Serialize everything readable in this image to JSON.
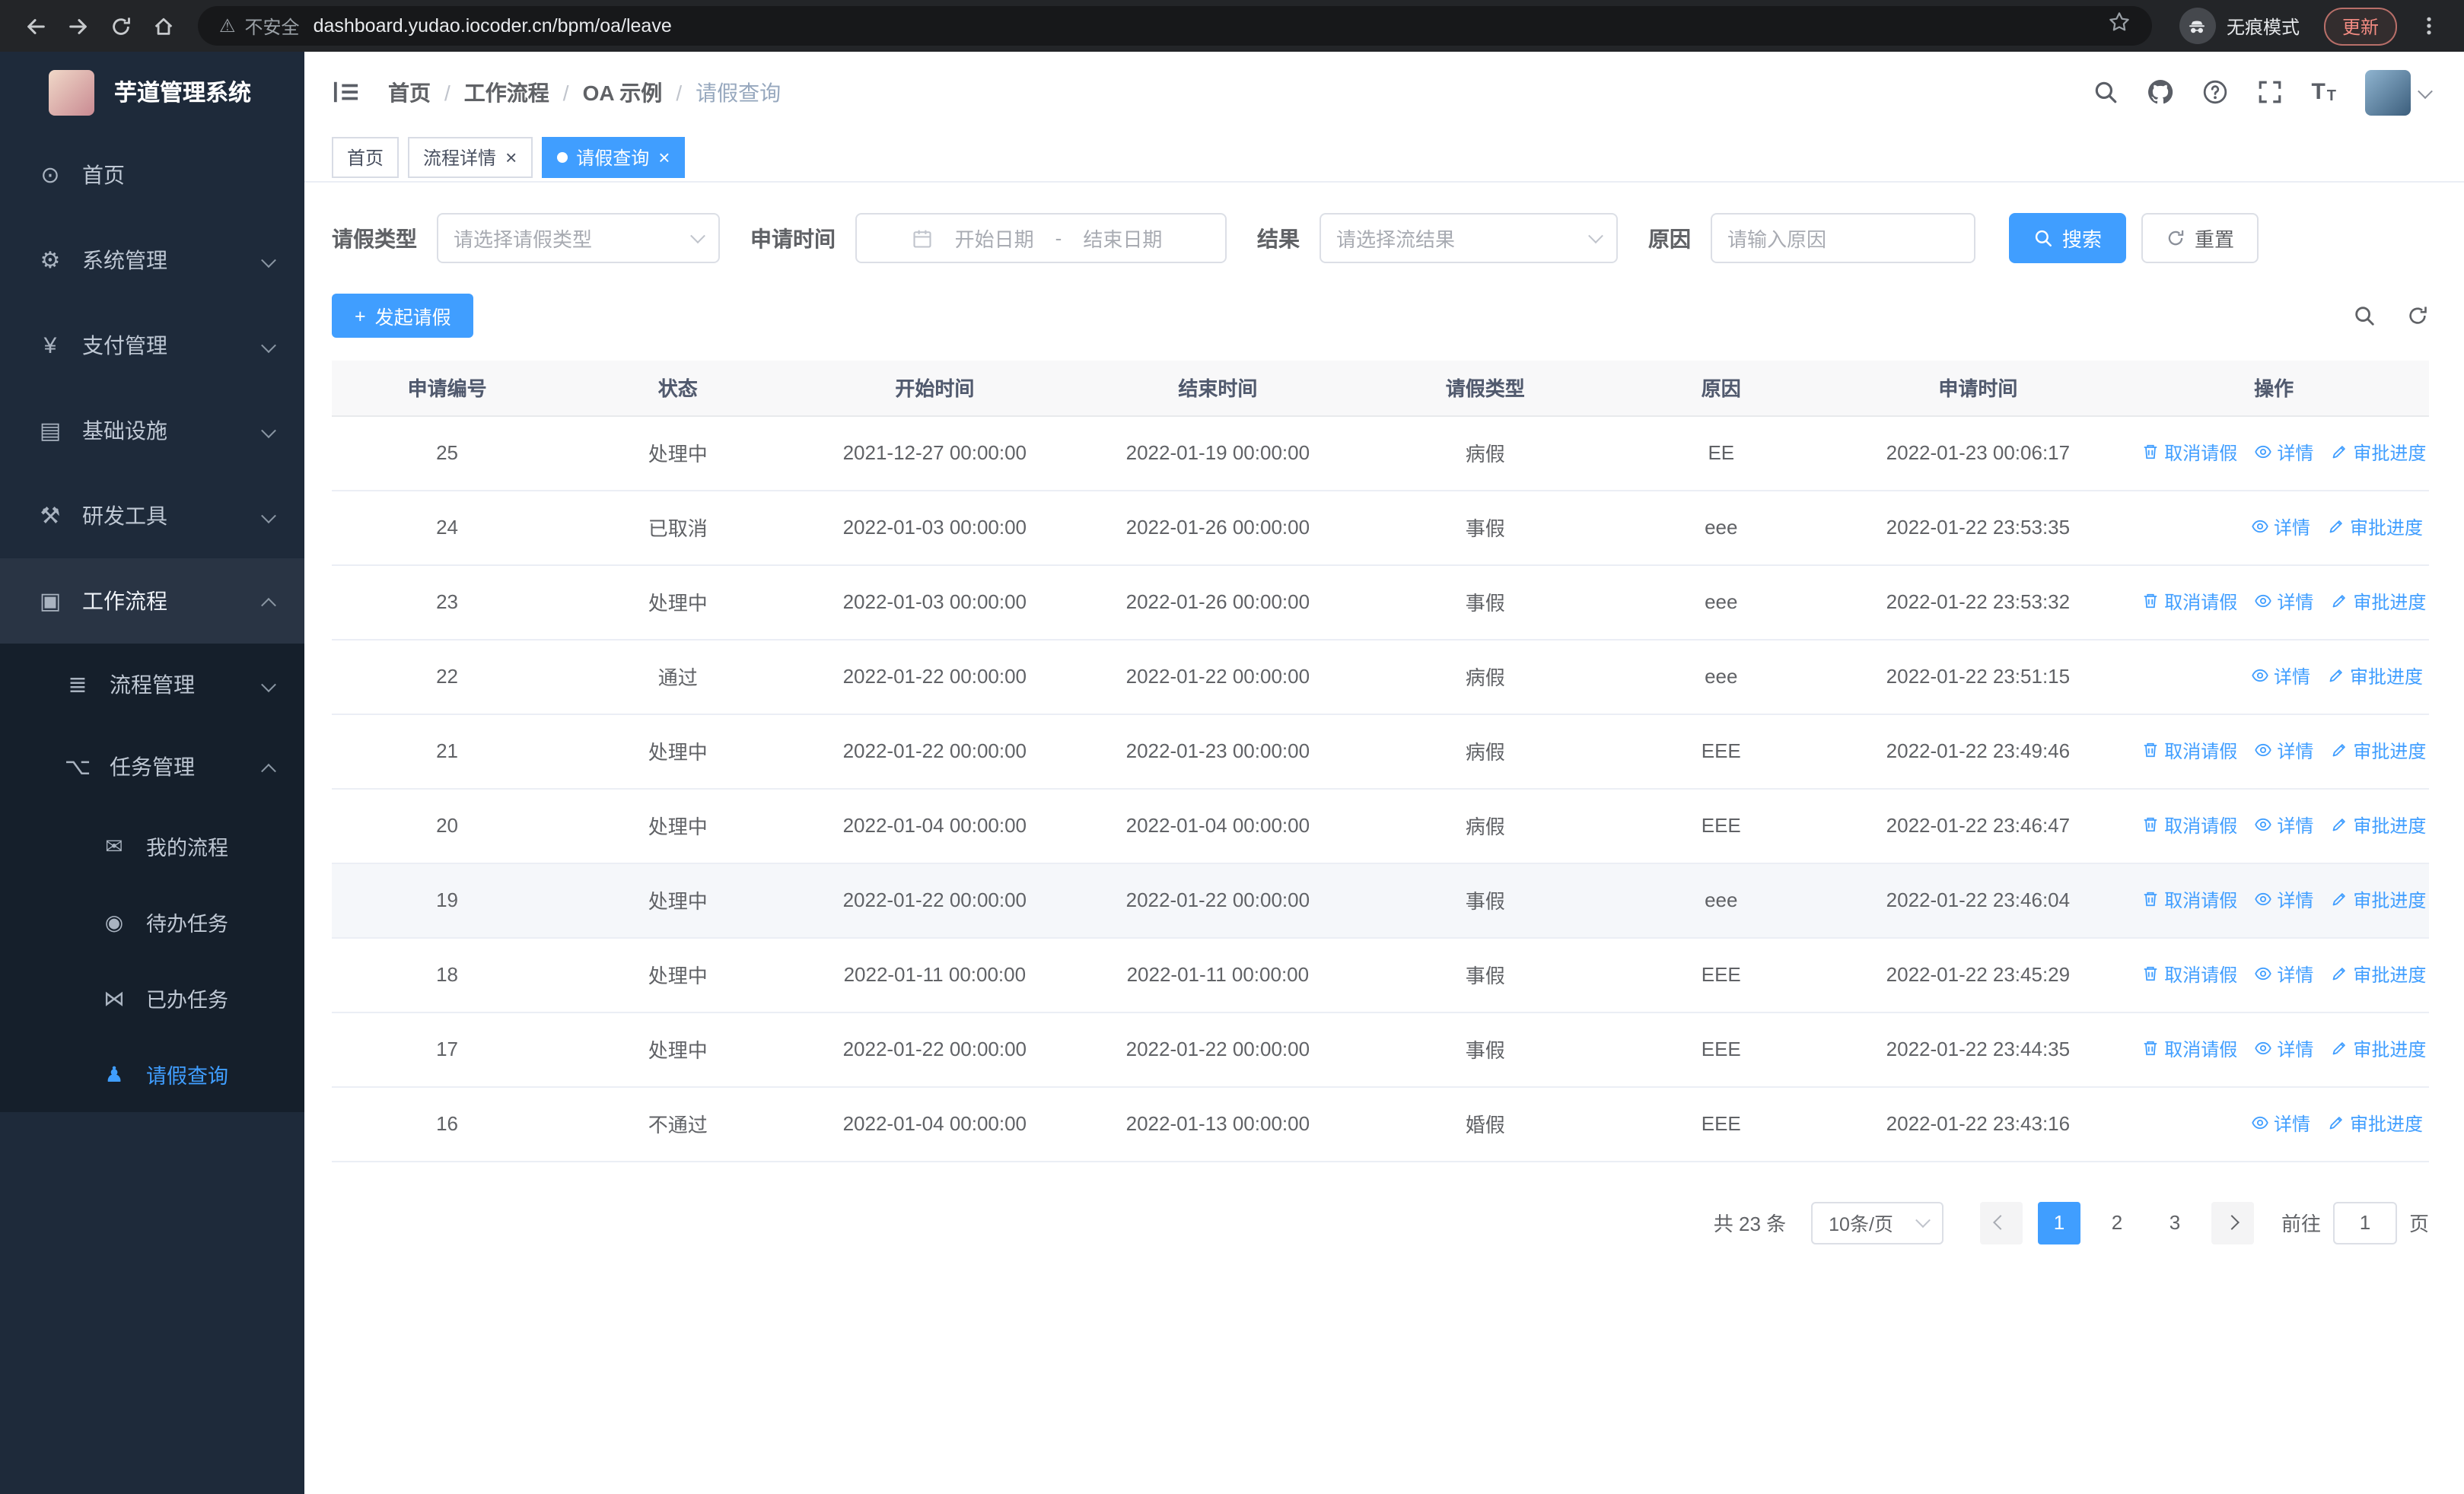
{
  "browser": {
    "security_label": "不安全",
    "url": "dashboard.yudao.iocoder.cn/bpm/oa/leave",
    "incognito_label": "无痕模式",
    "update_label": "更新"
  },
  "ui": {
    "close_glyph": "×",
    "warning_glyph": "⚠",
    "plus_glyph": "+",
    "font_icon_large": "T",
    "font_icon_small": "T"
  },
  "sidebar": {
    "logo_title": "芋道管理系统",
    "menu": [
      {
        "label": "首页",
        "glyph": "⊙"
      },
      {
        "label": "系统管理",
        "glyph": "⚙"
      },
      {
        "label": "支付管理",
        "glyph": "¥"
      },
      {
        "label": "基础设施",
        "glyph": "▤"
      },
      {
        "label": "研发工具",
        "glyph": "⚒"
      },
      {
        "label": "工作流程",
        "glyph": "▣"
      }
    ],
    "submenu": [
      {
        "label": "流程管理",
        "glyph": "≣"
      },
      {
        "label": "任务管理",
        "glyph": "⌥"
      }
    ],
    "task_items": [
      {
        "label": "我的流程",
        "glyph": "✉"
      },
      {
        "label": "待办任务",
        "glyph": "◉"
      },
      {
        "label": "已办任务",
        "glyph": "⋈"
      },
      {
        "label": "请假查询",
        "glyph": "♟"
      }
    ]
  },
  "header": {
    "breadcrumb": [
      "首页",
      "工作流程",
      "OA 示例",
      "请假查询"
    ],
    "separator": "/"
  },
  "tabs": [
    {
      "label": "首页"
    },
    {
      "label": "流程详情"
    },
    {
      "label": "请假查询"
    }
  ],
  "filters": {
    "leave_type_label": "请假类型",
    "leave_type_placeholder": "请选择请假类型",
    "apply_time_label": "申请时间",
    "start_date_placeholder": "开始日期",
    "range_separator": "-",
    "end_date_placeholder": "结束日期",
    "result_label": "结果",
    "result_placeholder": "请选择流结果",
    "reason_label": "原因",
    "reason_placeholder": "请输入原因",
    "search_label": "搜索",
    "reset_label": "重置"
  },
  "toolbar": {
    "create_label": "发起请假"
  },
  "table": {
    "columns": [
      "申请编号",
      "状态",
      "开始时间",
      "结束时间",
      "请假类型",
      "原因",
      "申请时间",
      "操作"
    ],
    "actions": {
      "cancel": "取消请假",
      "detail": "详情",
      "progress": "审批进度"
    },
    "rows": [
      {
        "id": "25",
        "status": "处理中",
        "start_time": "2021-12-27 00:00:00",
        "end_time": "2022-01-19 00:00:00",
        "leave_type": "病假",
        "reason": "EE",
        "apply_time": "2022-01-23 00:06:17",
        "cancellable": true,
        "highlighted": false
      },
      {
        "id": "24",
        "status": "已取消",
        "start_time": "2022-01-03 00:00:00",
        "end_time": "2022-01-26 00:00:00",
        "leave_type": "事假",
        "reason": "eee",
        "apply_time": "2022-01-22 23:53:35",
        "cancellable": false,
        "highlighted": false
      },
      {
        "id": "23",
        "status": "处理中",
        "start_time": "2022-01-03 00:00:00",
        "end_time": "2022-01-26 00:00:00",
        "leave_type": "事假",
        "reason": "eee",
        "apply_time": "2022-01-22 23:53:32",
        "cancellable": true,
        "highlighted": false
      },
      {
        "id": "22",
        "status": "通过",
        "start_time": "2022-01-22 00:00:00",
        "end_time": "2022-01-22 00:00:00",
        "leave_type": "病假",
        "reason": "eee",
        "apply_time": "2022-01-22 23:51:15",
        "cancellable": false,
        "highlighted": false
      },
      {
        "id": "21",
        "status": "处理中",
        "start_time": "2022-01-22 00:00:00",
        "end_time": "2022-01-23 00:00:00",
        "leave_type": "病假",
        "reason": "EEE",
        "apply_time": "2022-01-22 23:49:46",
        "cancellable": true,
        "highlighted": false
      },
      {
        "id": "20",
        "status": "处理中",
        "start_time": "2022-01-04 00:00:00",
        "end_time": "2022-01-04 00:00:00",
        "leave_type": "病假",
        "reason": "EEE",
        "apply_time": "2022-01-22 23:46:47",
        "cancellable": true,
        "highlighted": false
      },
      {
        "id": "19",
        "status": "处理中",
        "start_time": "2022-01-22 00:00:00",
        "end_time": "2022-01-22 00:00:00",
        "leave_type": "事假",
        "reason": "eee",
        "apply_time": "2022-01-22 23:46:04",
        "cancellable": true,
        "highlighted": true
      },
      {
        "id": "18",
        "status": "处理中",
        "start_time": "2022-01-11 00:00:00",
        "end_time": "2022-01-11 00:00:00",
        "leave_type": "事假",
        "reason": "EEE",
        "apply_time": "2022-01-22 23:45:29",
        "cancellable": true,
        "highlighted": false
      },
      {
        "id": "17",
        "status": "处理中",
        "start_time": "2022-01-22 00:00:00",
        "end_time": "2022-01-22 00:00:00",
        "leave_type": "事假",
        "reason": "EEE",
        "apply_time": "2022-01-22 23:44:35",
        "cancellable": true,
        "highlighted": false
      },
      {
        "id": "16",
        "status": "不通过",
        "start_time": "2022-01-04 00:00:00",
        "end_time": "2022-01-13 00:00:00",
        "leave_type": "婚假",
        "reason": "EEE",
        "apply_time": "2022-01-22 23:43:16",
        "cancellable": false,
        "highlighted": false
      }
    ]
  },
  "pagination": {
    "total_text": "共 23 条",
    "page_size_text": "10条/页",
    "pages": [
      "1",
      "2",
      "3"
    ],
    "active_page": "1",
    "goto_prefix": "前往",
    "goto_value": "1",
    "goto_suffix": "页"
  },
  "colors": {
    "accent": "#409eff",
    "sidebar_bg": "#1e2a3a",
    "sidebar_submenu_bg": "#151f2b"
  }
}
